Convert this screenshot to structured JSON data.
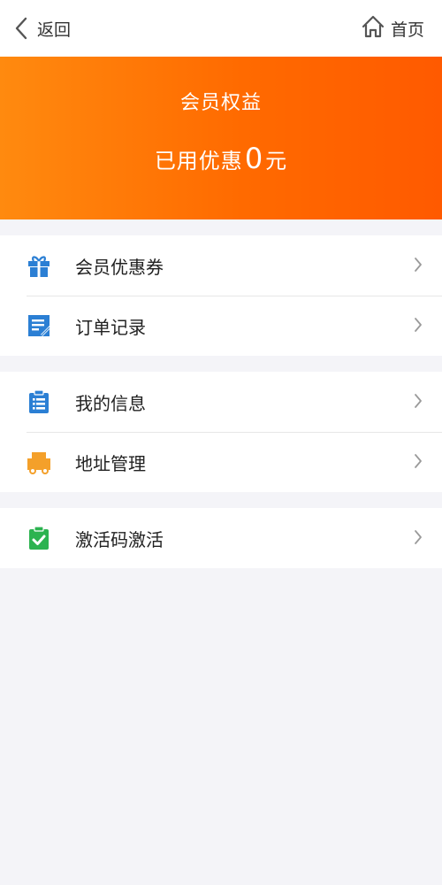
{
  "header": {
    "back_label": "返回",
    "home_label": "首页"
  },
  "banner": {
    "title": "会员权益",
    "used_prefix": "已用优惠",
    "used_amount": "0",
    "used_unit": "元",
    "gradient_start": "#ff8a0f",
    "gradient_end": "#ff5a00"
  },
  "menu": {
    "groups": [
      {
        "items": [
          {
            "label": "会员优惠券",
            "icon": "gift-icon",
            "color": "#2b7fd4"
          },
          {
            "label": "订单记录",
            "icon": "order-record-icon",
            "color": "#2b7fd4"
          }
        ]
      },
      {
        "items": [
          {
            "label": "我的信息",
            "icon": "clipboard-icon",
            "color": "#2b7fd4"
          },
          {
            "label": "地址管理",
            "icon": "truck-icon",
            "color": "#f4a02a"
          }
        ]
      },
      {
        "items": [
          {
            "label": "激活码激活",
            "icon": "activation-check-icon",
            "color": "#2cb350"
          }
        ]
      }
    ]
  },
  "colors": {
    "background": "#f4f4f8",
    "accent": "#ff6a00",
    "chevron": "#9a9a9a"
  }
}
